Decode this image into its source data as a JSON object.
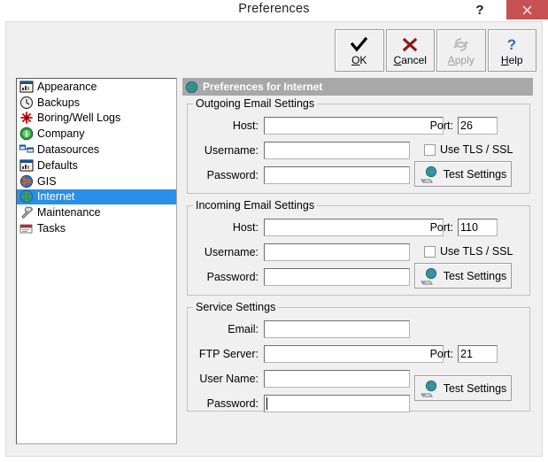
{
  "window": {
    "title": "Preferences",
    "help_button": "?",
    "close_button": "close-icon",
    "close_color": "#c75050"
  },
  "toolbar": {
    "buttons": [
      {
        "label": "OK",
        "accel": "O",
        "icon": "check-icon",
        "disabled": false
      },
      {
        "label": "Cancel",
        "accel": "C",
        "icon": "cross-icon",
        "disabled": false
      },
      {
        "label": "Apply",
        "accel": "A",
        "icon": "refresh-icon",
        "disabled": true
      },
      {
        "label": "Help",
        "accel": "H",
        "icon": "question-icon",
        "disabled": false
      }
    ]
  },
  "sidebar": {
    "items": [
      {
        "label": "Appearance",
        "icon": "window-chart-icon",
        "selected": false
      },
      {
        "label": "Backups",
        "icon": "clock-icon",
        "selected": false
      },
      {
        "label": "Boring/Well Logs",
        "icon": "red-star-icon",
        "selected": false
      },
      {
        "label": "Company",
        "icon": "green-info-icon",
        "selected": false
      },
      {
        "label": "Datasources",
        "icon": "database-link-icon",
        "selected": false
      },
      {
        "label": "Defaults",
        "icon": "window-chart-icon",
        "selected": false
      },
      {
        "label": "GIS",
        "icon": "globe-icon",
        "selected": false
      },
      {
        "label": "Internet",
        "icon": "globe-green-icon",
        "selected": true
      },
      {
        "label": "Maintenance",
        "icon": "wrench-icon",
        "selected": false
      },
      {
        "label": "Tasks",
        "icon": "tasks-icon",
        "selected": false
      }
    ],
    "selection_color": "#2a8fe6"
  },
  "main": {
    "header": {
      "title": "Preferences for Internet",
      "icon": "globe-green-icon",
      "background": "#a8a8a8"
    },
    "groups": [
      {
        "legend": "Outgoing Email Settings",
        "fields": [
          {
            "label": "Host:",
            "value": "",
            "placeholder": ""
          },
          {
            "label": "Username:",
            "value": "",
            "placeholder": ""
          },
          {
            "label": "Password:",
            "value": "",
            "placeholder": ""
          }
        ],
        "port": {
          "label": "Port:",
          "value": "26"
        },
        "checkbox": {
          "label": "Use TLS / SSL",
          "checked": false
        },
        "test_button": {
          "label": "Test Settings",
          "icon": "globe-modem-icon"
        }
      },
      {
        "legend": "Incoming Email Settings",
        "fields": [
          {
            "label": "Host:",
            "value": "",
            "placeholder": ""
          },
          {
            "label": "Username:",
            "value": "",
            "placeholder": ""
          },
          {
            "label": "Password:",
            "value": "",
            "placeholder": ""
          }
        ],
        "port": {
          "label": "Port:",
          "value": "110"
        },
        "checkbox": {
          "label": "Use TLS / SSL",
          "checked": false
        },
        "test_button": {
          "label": "Test Settings",
          "icon": "globe-modem-icon"
        }
      },
      {
        "legend": "Service Settings",
        "fields": [
          {
            "label": "Email:",
            "value": "",
            "placeholder": ""
          },
          {
            "label": "FTP Server:",
            "value": "",
            "placeholder": ""
          },
          {
            "label": "User Name:",
            "value": "",
            "placeholder": ""
          },
          {
            "label": "Password:",
            "value": "",
            "placeholder": "",
            "focused": true
          }
        ],
        "port": {
          "label": "Port:",
          "value": "21"
        },
        "test_button": {
          "label": "Test Settings",
          "icon": "globe-modem-icon"
        }
      }
    ]
  }
}
